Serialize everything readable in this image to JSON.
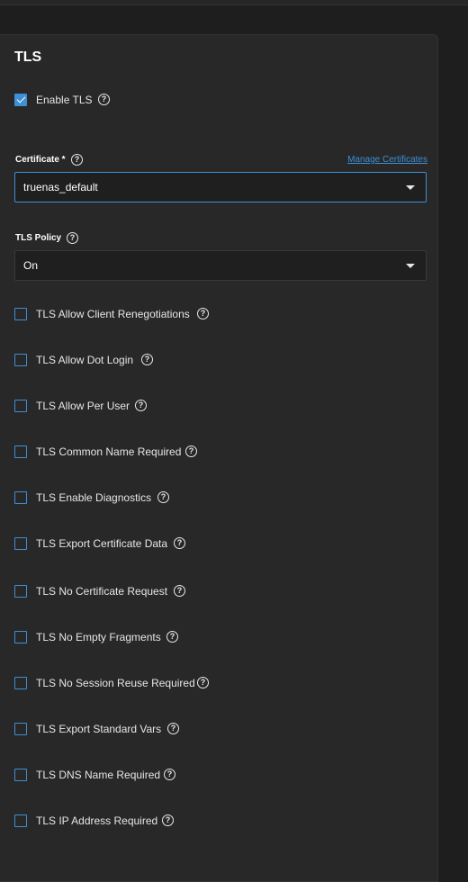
{
  "section": {
    "title": "TLS",
    "enable_tls": {
      "label": "Enable TLS",
      "checked": true
    },
    "certificate": {
      "label": "Certificate *",
      "value": "truenas_default",
      "manage_link": "Manage Certificates"
    },
    "tls_policy": {
      "label": "TLS Policy",
      "value": "On"
    },
    "options": [
      {
        "label": "TLS Allow Client Renegotiations",
        "checked": false
      },
      {
        "label": "TLS Allow Dot Login",
        "checked": false
      },
      {
        "label": "TLS Allow Per User",
        "checked": false
      },
      {
        "label": "TLS Common Name Required",
        "checked": false
      },
      {
        "label": "TLS Enable Diagnostics",
        "checked": false
      },
      {
        "label": "TLS Export Certificate Data",
        "checked": false
      },
      {
        "label": "TLS No Certificate Request",
        "checked": false
      },
      {
        "label": "TLS No Empty Fragments",
        "checked": false
      },
      {
        "label": "TLS No Session Reuse Required",
        "checked": false
      },
      {
        "label": "TLS Export Standard Vars",
        "checked": false
      },
      {
        "label": "TLS DNS Name Required",
        "checked": false
      },
      {
        "label": "TLS IP Address Required",
        "checked": false
      }
    ]
  },
  "icons": {
    "help": "help-circle-icon",
    "dropdown": "dropdown-arrow-icon",
    "check": "checkmark-icon"
  },
  "colors": {
    "accent": "#3d8fd6",
    "card_bg": "#282828",
    "page_bg": "#1e1e1e",
    "input_bg": "#1f1f1f"
  }
}
